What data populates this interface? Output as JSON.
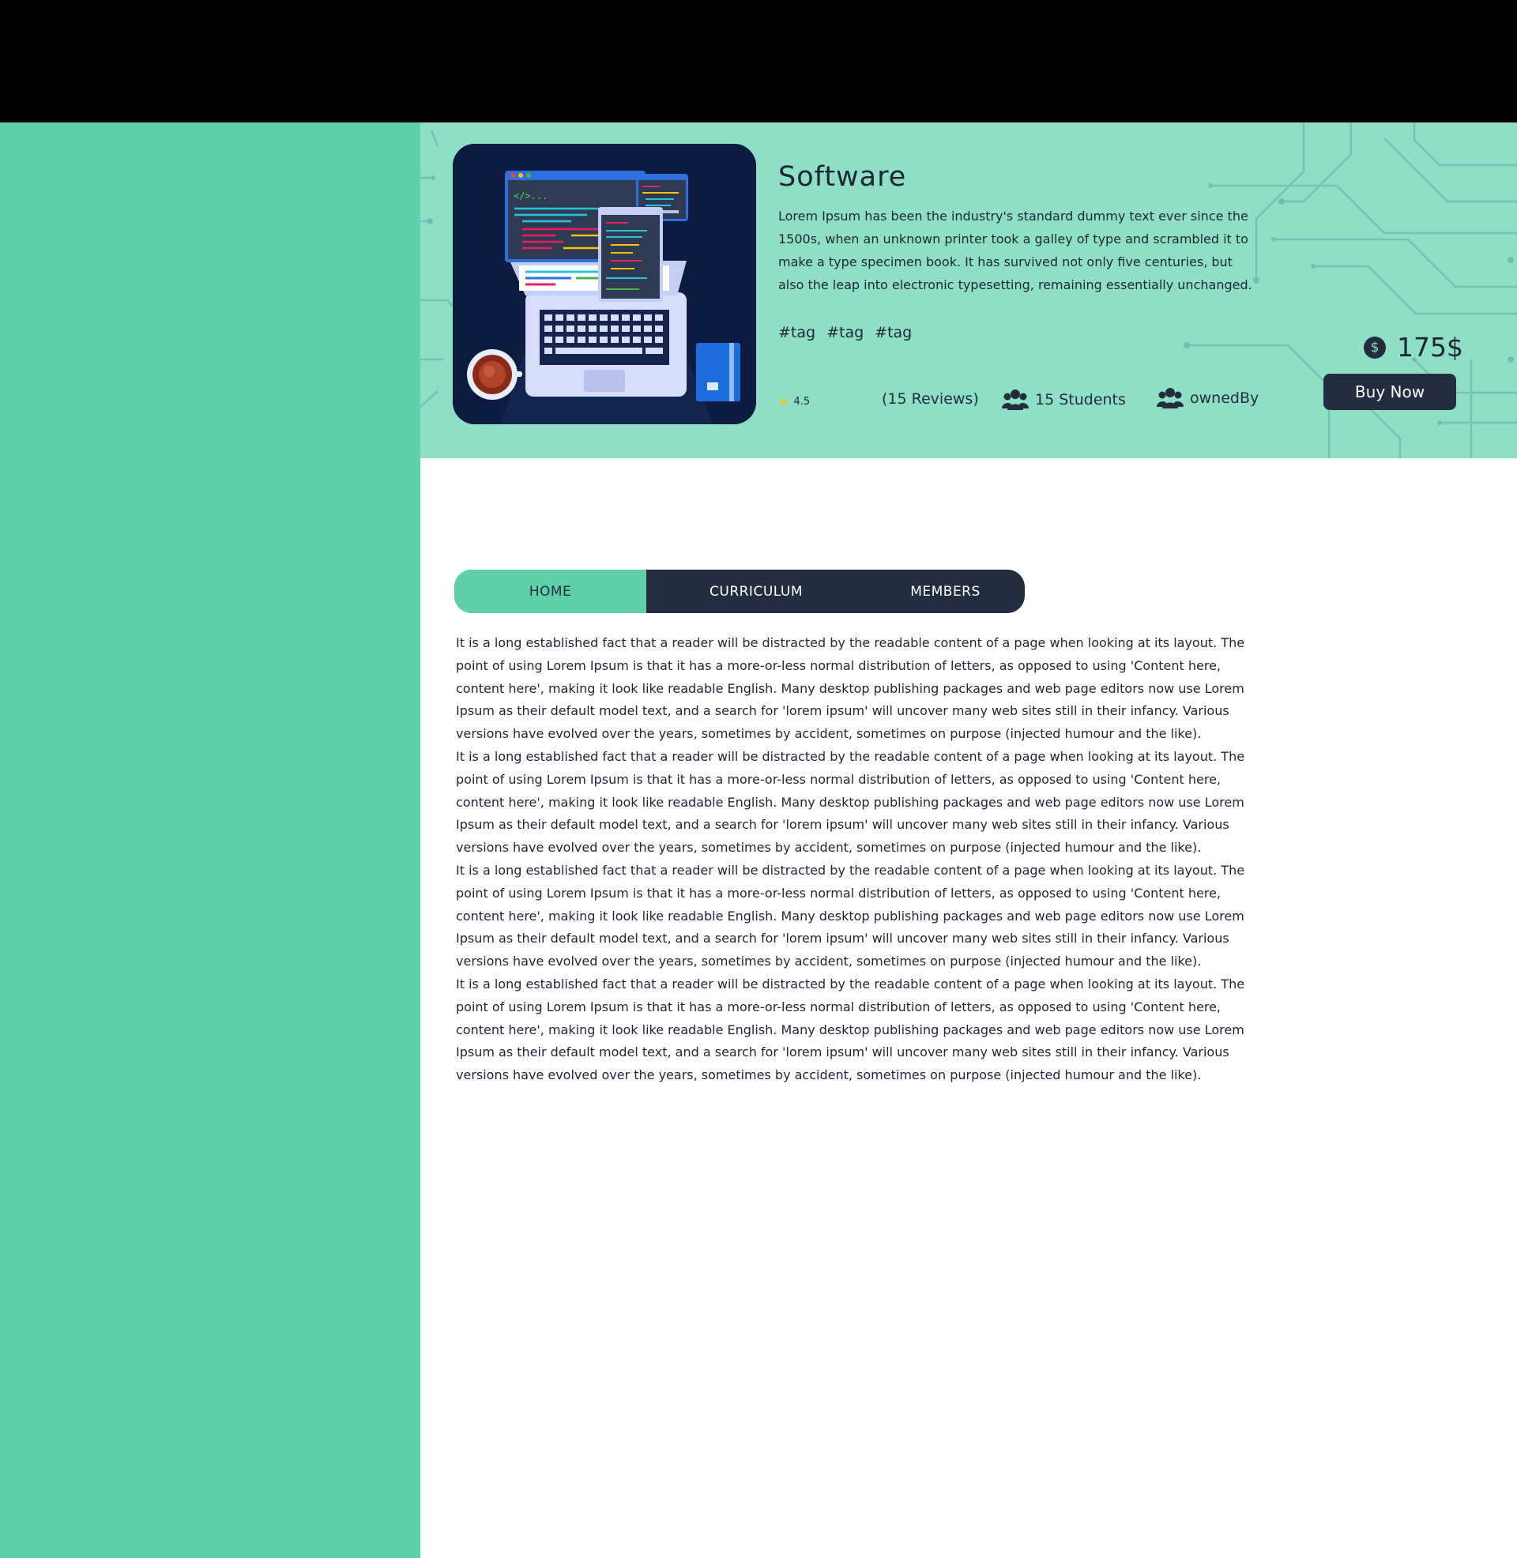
{
  "course": {
    "title": "Software",
    "description": "Lorem Ipsum has been the industry's standard dummy text ever since the 1500s, when an unknown printer took a galley of type and scrambled it to make a type specimen book. It has survived not only five centuries, but also the leap into electronic typesetting, remaining essentially unchanged.",
    "tags": [
      "#tag",
      "#tag",
      "#tag"
    ],
    "rating": "4.5",
    "reviews": "(15 Reviews)",
    "students": "15 Students",
    "owner": "ownedBy",
    "price": "175$",
    "buy_label": "Buy Now",
    "icons": {
      "rating": "star-icon",
      "students": "people-icon",
      "owner": "people-icon",
      "price": "dollar-icon"
    }
  },
  "tabs": [
    {
      "label": "HOME",
      "active": true
    },
    {
      "label": "CURRICULUM",
      "active": false
    },
    {
      "label": "MEMBERS",
      "active": false
    }
  ],
  "content": {
    "paragraphs": [
      "It is a long established fact that a reader will be distracted by the readable content of a page when looking at its layout. The point of using Lorem Ipsum is that it has a more-or-less normal distribution of letters, as opposed to using 'Content here, content here', making it look like readable English. Many desktop publishing packages and web page editors now use Lorem Ipsum as their default model text, and a search for 'lorem ipsum' will uncover many web sites still in their infancy. Various versions have evolved over the years, sometimes by accident, sometimes on purpose (injected humour and the like).",
      "It is a long established fact that a reader will be distracted by the readable content of a page when looking at its layout. The point of using Lorem Ipsum is that it has a more-or-less normal distribution of letters, as opposed to using 'Content here, content here', making it look like readable English. Many desktop publishing packages and web page editors now use Lorem Ipsum as their default model text, and a search for 'lorem ipsum' will uncover many web sites still in their infancy. Various versions have evolved over the years, sometimes by accident, sometimes on purpose (injected humour and the like).",
      "It is a long established fact that a reader will be distracted by the readable content of a page when looking at its layout. The point of using Lorem Ipsum is that it has a more-or-less normal distribution of letters, as opposed to using 'Content here, content here', making it look like readable English. Many desktop publishing packages and web page editors now use Lorem Ipsum as their default model text, and a search for 'lorem ipsum' will uncover many web sites still in their infancy. Various versions have evolved over the years, sometimes by accident, sometimes on purpose (injected humour and the like).",
      "It is a long established fact that a reader will be distracted by the readable content of a page when looking at its layout. The point of using Lorem Ipsum is that it has a more-or-less normal distribution of letters, as opposed to using 'Content here, content here', making it look like readable English. Many desktop publishing packages and web page editors now use Lorem Ipsum as their default model text, and a search for 'lorem ipsum' will uncover many web sites still in their infancy. Various versions have evolved over the years, sometimes by accident, sometimes on purpose (injected humour and the like)."
    ]
  },
  "colors": {
    "sidebar": "#5fd0aa",
    "hero_bg": "#8fdfc7",
    "dark": "#232d3f",
    "top_bar": "#000000",
    "star": "#f5c518"
  }
}
